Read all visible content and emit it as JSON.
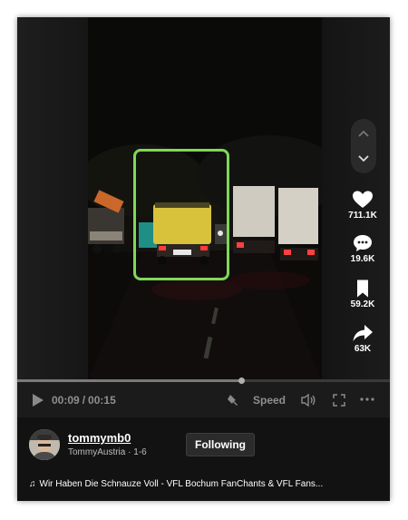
{
  "player": {
    "time_current": "00:09",
    "time_separator": "/",
    "time_total": "00:15",
    "progress": 0.6,
    "speed_label": "Speed"
  },
  "actions": {
    "likes": "711.1K",
    "comments": "19.6K",
    "saves": "59.2K",
    "shares": "63K"
  },
  "author": {
    "username": "tommymb0",
    "display_name": "TommyAustria",
    "separator": "·",
    "date": "1-6",
    "follow_label": "Following"
  },
  "music": {
    "note_icon": "♫",
    "title": "Wir Haben Die Schnauze Voll - VFL Bochum FanChants & VFL Fans..."
  },
  "colors": {
    "highlight": "#7ed957",
    "card_bg": "#121212"
  }
}
